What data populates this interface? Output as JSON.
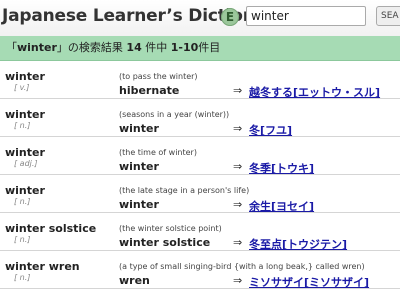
{
  "header": {
    "app_title": "Japanese Learner’s Dictionary",
    "lang_badge": "E",
    "search_value": "winter",
    "search_button": "SEA"
  },
  "results": {
    "open_quote": "「",
    "query": "winter",
    "close_text": "」の検索結果 ",
    "count": "14",
    "mid_text": " 件中 ",
    "range": "1-10",
    "end_text": "件目"
  },
  "entries": [
    {
      "word": "winter",
      "pos": "[ v.]",
      "gloss": "(to pass the winter)",
      "translation": "hibernate",
      "arrow": "⇒",
      "japanese": "越冬する[エットウ・スル]"
    },
    {
      "word": "winter",
      "pos": "[ n.]",
      "gloss": "(seasons in a year (winter))",
      "translation": "winter",
      "arrow": "⇒",
      "japanese": "冬[フユ]"
    },
    {
      "word": "winter",
      "pos": "[ adj.]",
      "gloss": "(the time of winter)",
      "translation": "winter",
      "arrow": "⇒",
      "japanese": "冬季[トウキ]"
    },
    {
      "word": "winter",
      "pos": "[ n.]",
      "gloss": "(the late stage in a person's life)",
      "translation": "winter",
      "arrow": "⇒",
      "japanese": "余生[ヨセイ]"
    },
    {
      "word": "winter solstice",
      "pos": "[ n.]",
      "gloss": "(the winter solstice point)",
      "translation": "winter solstice",
      "arrow": "⇒",
      "japanese": "冬至点[トウジテン]"
    },
    {
      "word": "winter wren",
      "pos": "[ n.]",
      "gloss": "(a type of small singing-bird {with a long beak,} called wren)",
      "translation": "wren",
      "arrow": "⇒",
      "japanese": "ミソサザイ[ミソサザイ]"
    }
  ]
}
